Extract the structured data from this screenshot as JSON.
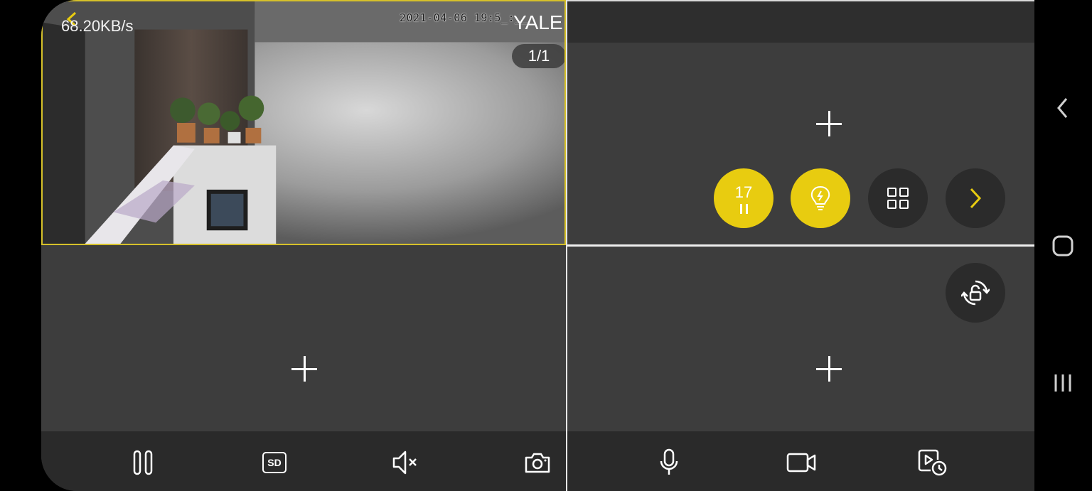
{
  "feed": {
    "speed": "68.20KB/s",
    "timestamp": "2021-04-06 19:5_:__",
    "camera_name": "YALE",
    "page_indicator": "1/1"
  },
  "controls": {
    "timer_value": "17"
  },
  "colors": {
    "accent": "#e8cc10",
    "panel_bg": "#3d3d3d",
    "toolbar_bg": "#2a2a2a",
    "selected_border": "#d6c12a"
  },
  "toolbar_icons": [
    "pause-icon",
    "sd-card-icon",
    "mute-icon",
    "snapshot-icon",
    "microphone-icon",
    "record-video-icon",
    "playback-icon"
  ],
  "navbar_icons": [
    "nav-back-icon",
    "nav-home-icon",
    "nav-recents-icon"
  ],
  "sd_label": "SD"
}
